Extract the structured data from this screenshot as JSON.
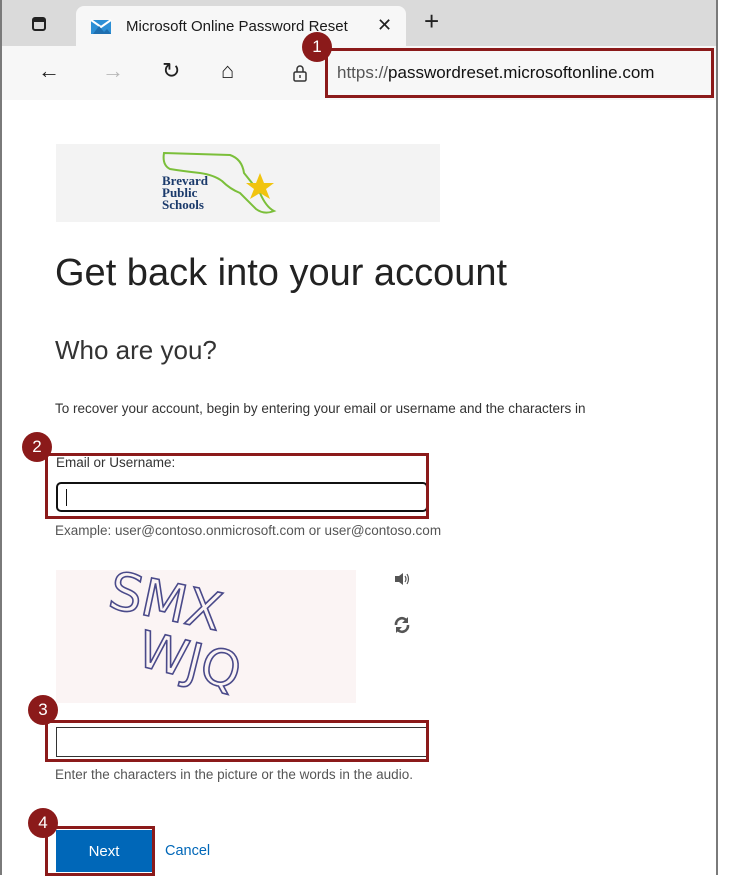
{
  "browser": {
    "tab": {
      "title": "Microsoft Online Password Reset",
      "close_glyph": "✕"
    },
    "new_tab_glyph": "+",
    "back_glyph": "←",
    "forward_glyph": "→",
    "refresh_glyph": "↻",
    "home_glyph": "⌂",
    "address": {
      "protocol": "https://",
      "host": "passwordreset.microsoftonline.com"
    }
  },
  "page": {
    "logo": {
      "line1": "Brevard",
      "line2": "Public",
      "line3": "Schools"
    },
    "title": "Get back into your account",
    "subtitle": "Who are you?",
    "description": "To recover your account, begin by entering your email or username and the characters in",
    "email_label": "Email or Username:",
    "email_value": "",
    "example": "Example: user@contoso.onmicrosoft.com or user@contoso.com",
    "captcha": {
      "line1": "SMX",
      "line2": "WJQ"
    },
    "captcha_value": "",
    "captcha_hint": "Enter the characters in the picture or the words in the audio.",
    "next_label": "Next",
    "cancel_label": "Cancel"
  },
  "callouts": [
    {
      "number": "1",
      "target": "address-bar"
    },
    {
      "number": "2",
      "target": "email-field"
    },
    {
      "number": "3",
      "target": "captcha-field"
    },
    {
      "number": "4",
      "target": "next-button"
    }
  ],
  "colors": {
    "accent": "#0067b8",
    "callout": "#8b1a1a"
  }
}
